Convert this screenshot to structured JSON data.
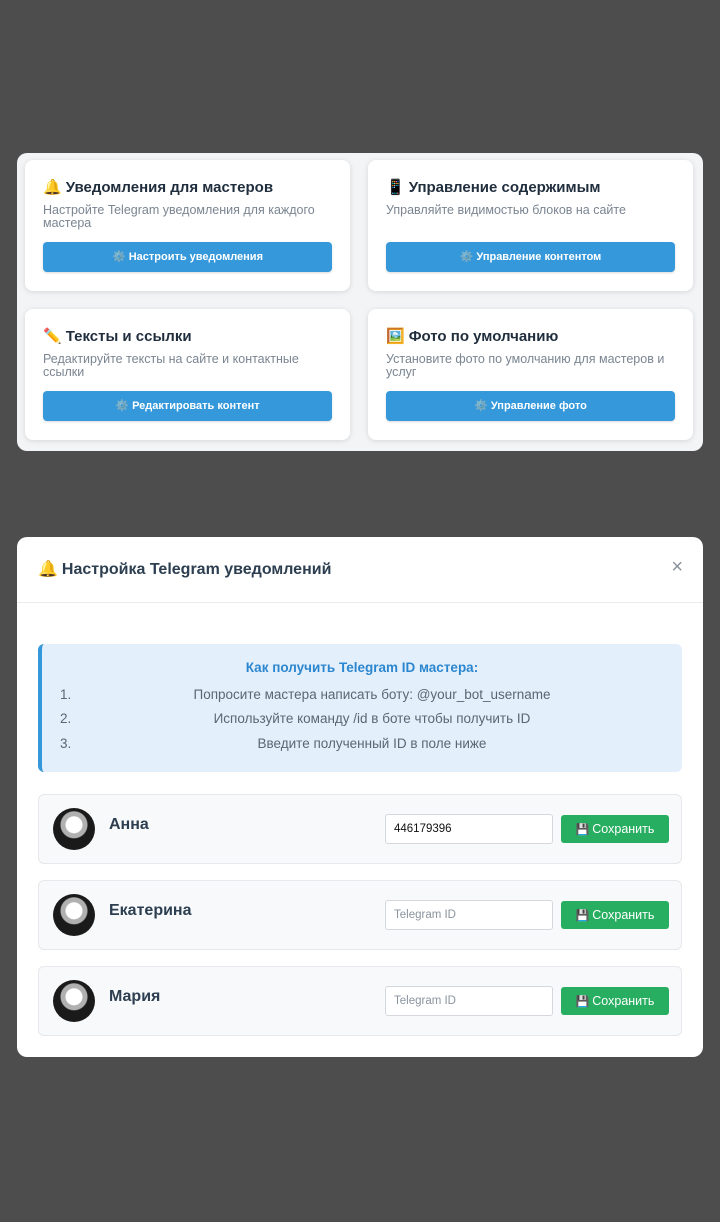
{
  "cards": [
    {
      "icon": "🔔",
      "icon_name": "bell-icon",
      "title": "Уведомления для мастеров",
      "description": "Настройте Telegram уведомления для каждого мастера",
      "button_icon": "⚙️",
      "button": "Настроить уведомления"
    },
    {
      "icon": "📱",
      "icon_name": "phone-icon",
      "title": "Управление содержимым",
      "description": "Управляйте видимостью блоков на сайте",
      "button_icon": "⚙️",
      "button": "Управление контентом"
    },
    {
      "icon": "✏️",
      "icon_name": "pencil-icon",
      "title": "Тексты и ссылки",
      "description": "Редактируйте тексты на сайте и контактные ссылки",
      "button_icon": "⚙️",
      "button": "Редактировать контент"
    },
    {
      "icon": "🖼️",
      "icon_name": "picture-icon",
      "title": "Фото по умолчанию",
      "description": "Установите фото по умолчанию для мастеров и услуг",
      "button_icon": "⚙️",
      "button": "Управление фото"
    }
  ],
  "modal": {
    "icon": "🔔",
    "title": "Настройка Telegram уведомлений",
    "close": "×",
    "info": {
      "title": "Как получить Telegram ID мастера:",
      "steps": [
        {
          "num": "1.",
          "text": "Попросите мастера написать боту: @your_bot_username"
        },
        {
          "num": "2.",
          "text": "Используйте команду /id в боте чтобы получить ID"
        },
        {
          "num": "3.",
          "text": "Введите полученный ID в поле ниже"
        }
      ]
    },
    "masters": [
      {
        "name": "Анна",
        "telegram_id": "446179396",
        "placeholder": "Telegram ID",
        "save_icon": "💾",
        "save": "Сохранить"
      },
      {
        "name": "Екатерина",
        "telegram_id": "",
        "placeholder": "Telegram ID",
        "save_icon": "💾",
        "save": "Сохранить"
      },
      {
        "name": "Мария",
        "telegram_id": "",
        "placeholder": "Telegram ID",
        "save_icon": "💾",
        "save": "Сохранить"
      }
    ]
  },
  "colors": {
    "backdrop": "#4d4d4d",
    "primary": "#3498db",
    "success": "#27ae60",
    "info_bg": "#e3f0fb",
    "title_text": "#2c3e50"
  }
}
